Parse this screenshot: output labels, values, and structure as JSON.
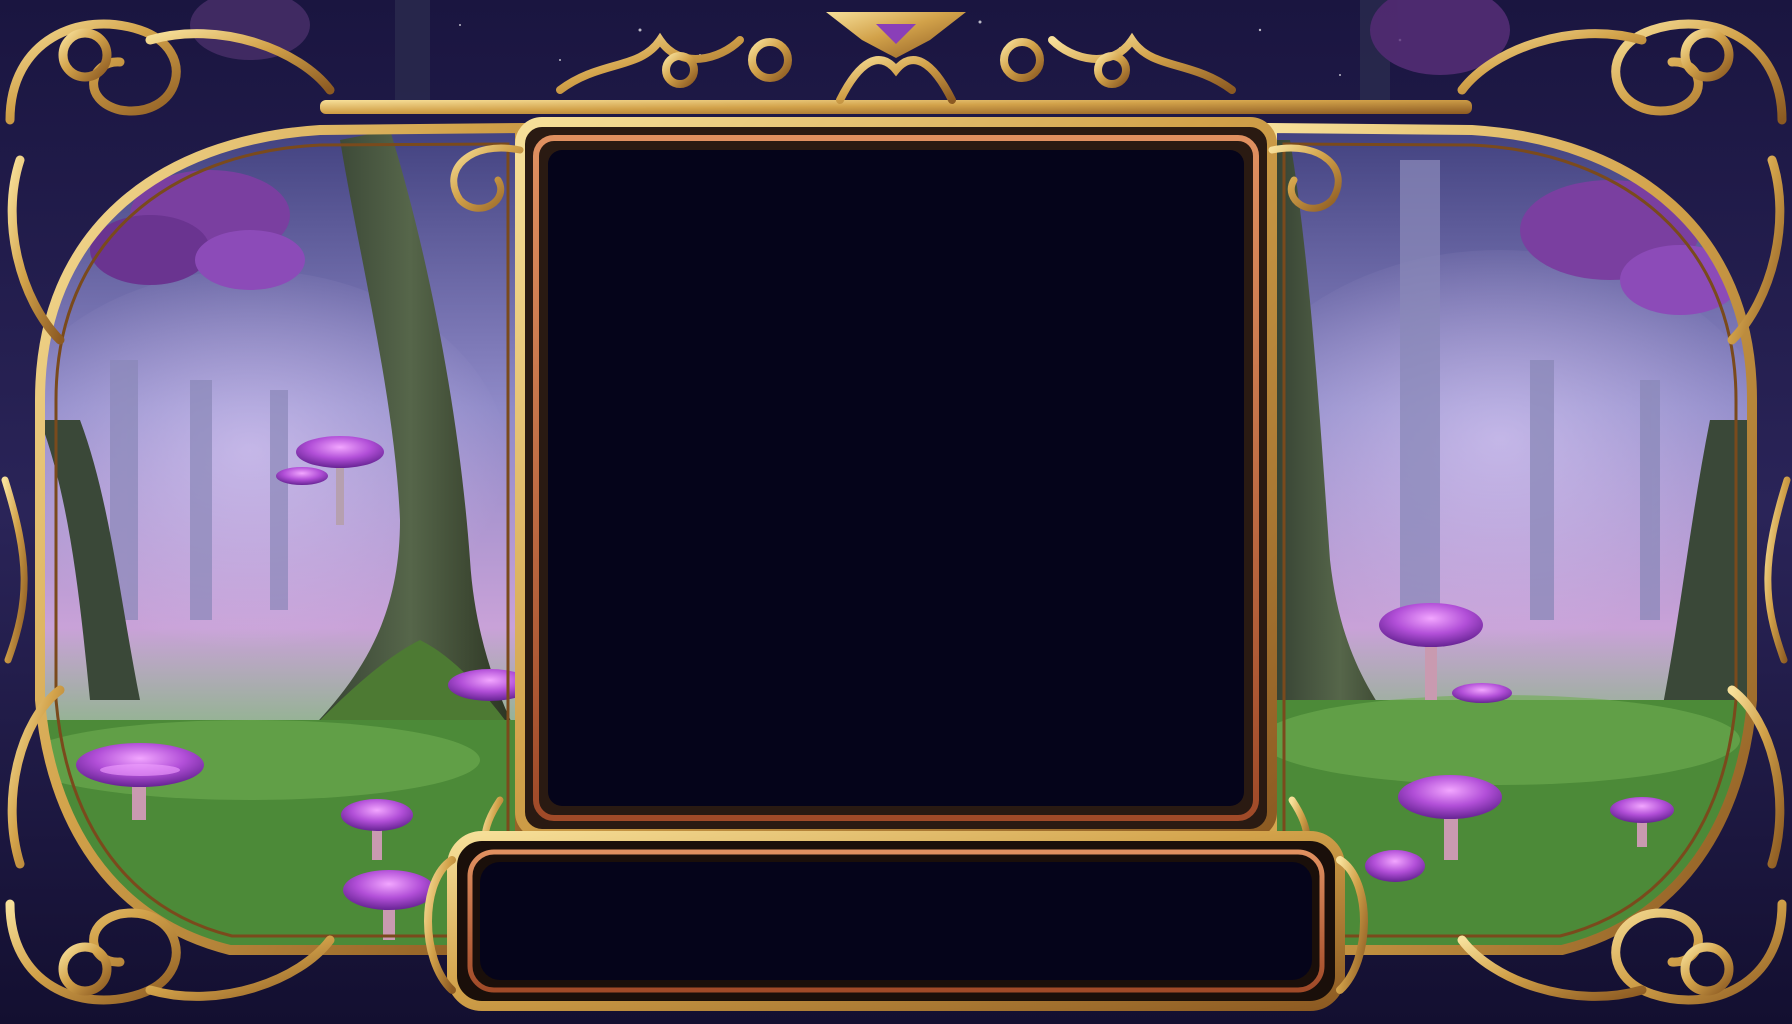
{
  "screen": {
    "type": "game-frame-overlay",
    "theme": "enchanted-forest",
    "title": "",
    "caption": ""
  },
  "colors": {
    "background_sky": "#1a1540",
    "frame_gold": "#d8b05a",
    "frame_gold_light": "#f3d98e",
    "frame_bronze": "#b5643a",
    "screen_fill": "#05041a",
    "mushroom_cap": "#b050d8",
    "mushroom_glow": "#f0a0ff",
    "grass": "#4f8f3c",
    "fog": "#c8a0e0"
  },
  "icons": [
    "mushroom-icon",
    "tree-icon",
    "gem-crest-icon",
    "scroll-ornament-icon"
  ]
}
